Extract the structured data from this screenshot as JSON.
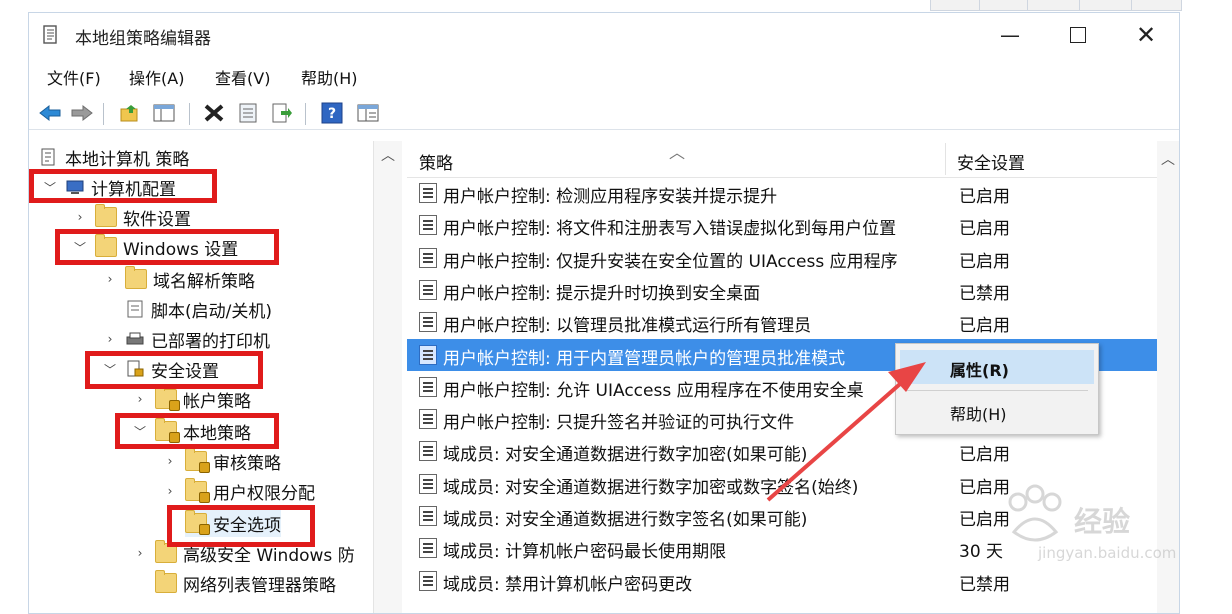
{
  "window": {
    "title": "本地组策略编辑器"
  },
  "menu": {
    "file": "文件(F)",
    "action": "操作(A)",
    "view": "查看(V)",
    "help": "帮助(H)"
  },
  "tree": {
    "root": "本地计算机 策略",
    "computer_config": "计算机配置",
    "software_settings": "软件设置",
    "windows_settings": "Windows 设置",
    "dns_policy": "域名解析策略",
    "scripts": "脚本(启动/关机)",
    "printers": "已部署的打印机",
    "security_settings": "安全设置",
    "account_policy": "帐户策略",
    "local_policy": "本地策略",
    "audit_policy": "审核策略",
    "user_rights": "用户权限分配",
    "security_options": "安全选项",
    "advanced_firewall": "高级安全 Windows 防",
    "network_list": "网络列表管理器策略"
  },
  "list": {
    "col_policy": "策略",
    "col_setting": "安全设置",
    "rows": [
      {
        "name": "用户帐户控制: 检测应用程序安装并提示提升",
        "value": "已启用"
      },
      {
        "name": "用户帐户控制: 将文件和注册表写入错误虚拟化到每用户位置",
        "value": "已启用"
      },
      {
        "name": "用户帐户控制: 仅提升安装在安全位置的 UIAccess 应用程序",
        "value": "已启用"
      },
      {
        "name": "用户帐户控制: 提示提升时切换到安全桌面",
        "value": "已禁用"
      },
      {
        "name": "用户帐户控制: 以管理员批准模式运行所有管理员",
        "value": "已启用"
      },
      {
        "name": "用户帐户控制: 用于内置管理员帐户的管理员批准模式",
        "value": ""
      },
      {
        "name": "用户帐户控制: 允许 UIAccess 应用程序在不使用安全桌",
        "value": ""
      },
      {
        "name": "用户帐户控制: 只提升签名并验证的可执行文件",
        "value": ""
      },
      {
        "name": "域成员: 对安全通道数据进行数字加密(如果可能)",
        "value": "已启用"
      },
      {
        "name": "域成员: 对安全通道数据进行数字加密或数字签名(始终)",
        "value": "已启用"
      },
      {
        "name": "域成员: 对安全通道数据进行数字签名(如果可能)",
        "value": "已启用"
      },
      {
        "name": "域成员: 计算机帐户密码最长使用期限",
        "value": "30 天"
      },
      {
        "name": "域成员: 禁用计算机帐户密码更改",
        "value": "已禁用"
      }
    ]
  },
  "context_menu": {
    "properties": "属性(R)",
    "help": "帮助(H)"
  },
  "watermark": {
    "brand": "经验",
    "url": "jingyan.baidu.com"
  },
  "colors": {
    "highlight_red": "#e01b1b",
    "selection_blue": "#3d8ee8",
    "menu_hover": "#cce3f7"
  }
}
